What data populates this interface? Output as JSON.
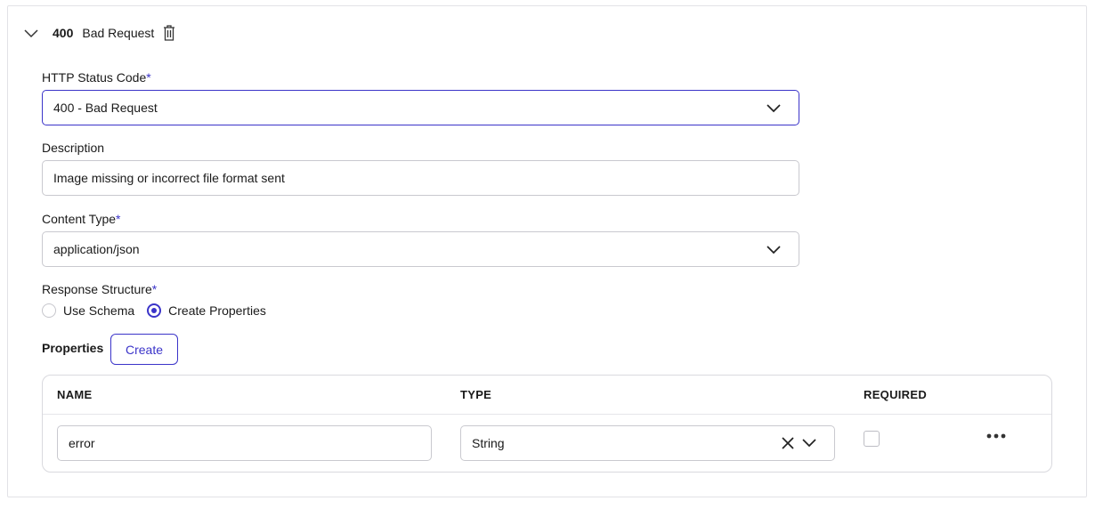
{
  "response": {
    "code": "400",
    "title": "Bad Request"
  },
  "form": {
    "status_code_label": "HTTP Status Code",
    "required_mark": "*",
    "status_code_value": "400 - Bad Request",
    "description_label": "Description",
    "description_value": "Image missing or incorrect file format sent",
    "content_type_label": "Content Type",
    "content_type_value": "application/json",
    "structure_label": "Response Structure",
    "structure_options": [
      {
        "label": "Use Schema",
        "selected": false
      },
      {
        "label": "Create Properties",
        "selected": true
      }
    ]
  },
  "properties": {
    "label": "Properties",
    "create_button": "Create",
    "columns": [
      "NAME",
      "TYPE",
      "REQUIRED"
    ],
    "rows": [
      {
        "name": "error",
        "type": "String",
        "required": false
      }
    ]
  },
  "colors": {
    "accent": "#3b34c9",
    "border": "#c9c9cf"
  },
  "icons": [
    "chevron-down-icon",
    "trash-icon",
    "clear-icon",
    "more-icon"
  ]
}
